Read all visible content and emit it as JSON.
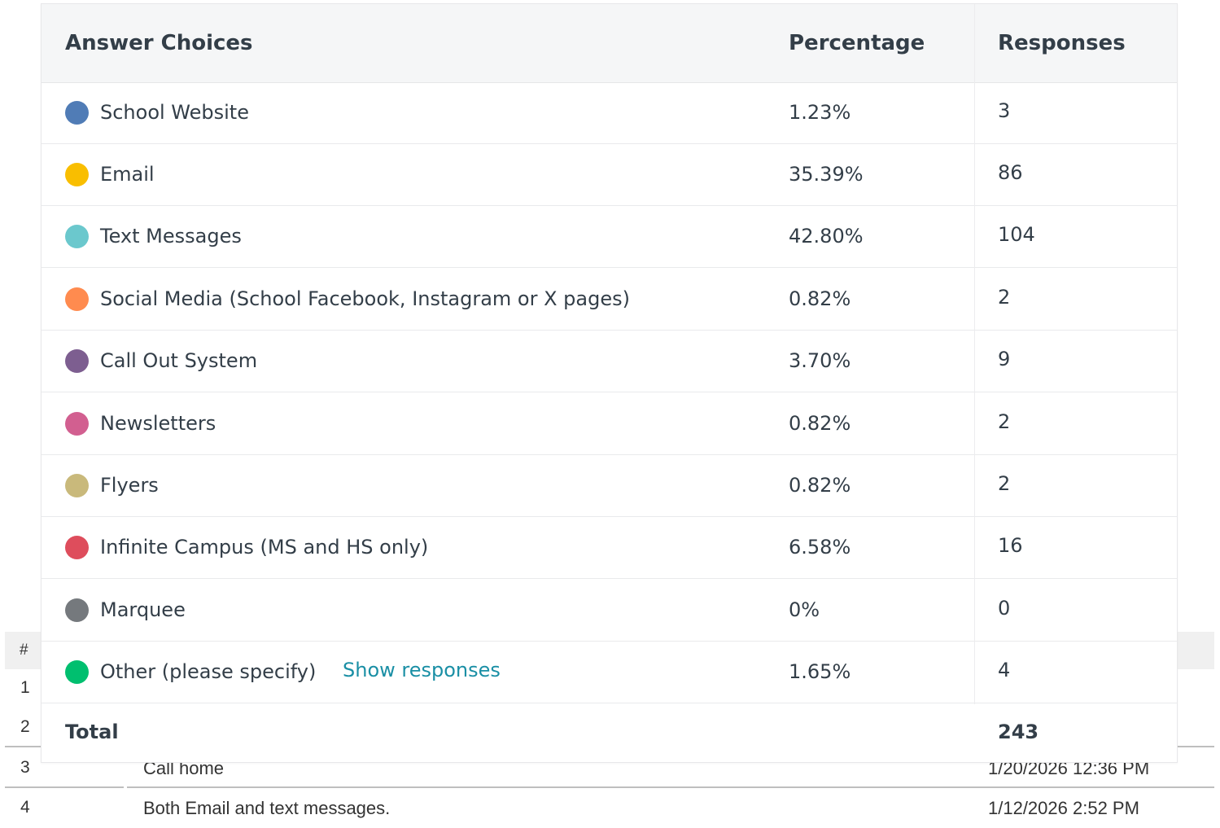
{
  "answer_table": {
    "headers": {
      "choice": "Answer Choices",
      "percentage": "Percentage",
      "responses": "Responses"
    },
    "rows": [
      {
        "label": "School Website",
        "percentage": "1.23%",
        "responses": "3",
        "color": "#507cb6"
      },
      {
        "label": "Email",
        "percentage": "35.39%",
        "responses": "86",
        "color": "#f9be00"
      },
      {
        "label": "Text Messages",
        "percentage": "42.80%",
        "responses": "104",
        "color": "#6bc8cd"
      },
      {
        "label": "Social Media (School Facebook, Instagram or X pages)",
        "percentage": "0.82%",
        "responses": "2",
        "color": "#ff8b4f"
      },
      {
        "label": "Call Out System",
        "percentage": "3.70%",
        "responses": "9",
        "color": "#7d5e90"
      },
      {
        "label": "Newsletters",
        "percentage": "0.82%",
        "responses": "2",
        "color": "#d25f90"
      },
      {
        "label": "Flyers",
        "percentage": "0.82%",
        "responses": "2",
        "color": "#c9b97b"
      },
      {
        "label": "Infinite Campus (MS and HS only)",
        "percentage": "6.58%",
        "responses": "16",
        "color": "#de4d5c"
      },
      {
        "label": "Marquee",
        "percentage": "0%",
        "responses": "0",
        "color": "#75797d"
      },
      {
        "label": "Other (please specify)",
        "percentage": "1.65%",
        "responses": "4",
        "color": "#00bf6f",
        "link": "Show responses"
      }
    ],
    "total": {
      "label": "Total",
      "value": "243"
    }
  },
  "other_responses": {
    "header_hash": "#",
    "rows": [
      {
        "num": "1",
        "text": "",
        "date": ""
      },
      {
        "num": "2",
        "text": "",
        "date": ""
      },
      {
        "num": "3",
        "text": "Call home",
        "date": "1/20/2026 12:36 PM"
      },
      {
        "num": "4",
        "text": "Both Email and text messages.",
        "date": "1/12/2026 2:52 PM"
      }
    ]
  }
}
